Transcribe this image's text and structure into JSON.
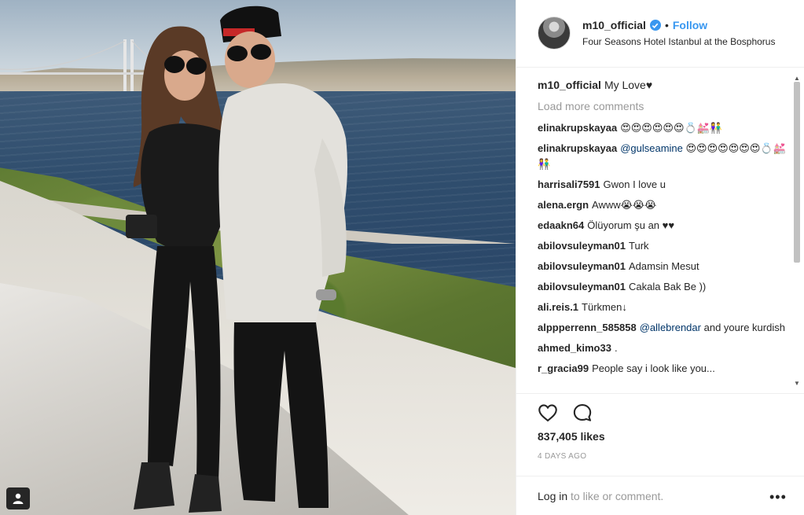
{
  "post": {
    "username": "m10_official",
    "follow_label": "Follow",
    "separator": "•",
    "location": "Four Seasons Hotel Istanbul at the Bosphorus",
    "caption_user": "m10_official",
    "caption_text": "My Love♥",
    "load_more": "Load more comments",
    "likes": "837,405 likes",
    "time": "4 DAYS AGO",
    "login_link": "Log in",
    "login_rest": "to like or comment.",
    "more": "•••"
  },
  "comments": [
    {
      "user": "elinakrupskayaa",
      "text": "😍😍😍😍😍😍💍💒👫"
    },
    {
      "user": "elinakrupskayaa",
      "mention": "@gulseamine",
      "text": "😍😍😍😍😍😍😍💍💒👫"
    },
    {
      "user": "harrisali7591",
      "text": "Gwon I love u"
    },
    {
      "user": "alena.ergn",
      "text": "Awww😭😭😭"
    },
    {
      "user": "edaakn64",
      "text": "Ölüyorum şu an ♥♥"
    },
    {
      "user": "abilovsuleyman01",
      "text": "Turk"
    },
    {
      "user": "abilovsuleyman01",
      "text": "Adamsin Mesut"
    },
    {
      "user": "abilovsuleyman01",
      "text": "Cakala Bak Be ))"
    },
    {
      "user": "ali.reis.1",
      "text": "Türkmen↓"
    },
    {
      "user": "alppperrenn_585858",
      "mention": "@allebrendar",
      "text": "and youre kurdish"
    },
    {
      "user": "ahmed_kimo33",
      "text": "."
    },
    {
      "user": "r_gracia99",
      "text": "People say i look like you..."
    }
  ],
  "colors": {
    "accent": "#3897f0",
    "text": "#262626",
    "muted": "#999999",
    "border": "#efefef"
  },
  "icons": {
    "heart": "heart-icon",
    "comment": "comment-icon",
    "verified": "verified-badge-icon",
    "user_tag": "user-tag-icon"
  }
}
